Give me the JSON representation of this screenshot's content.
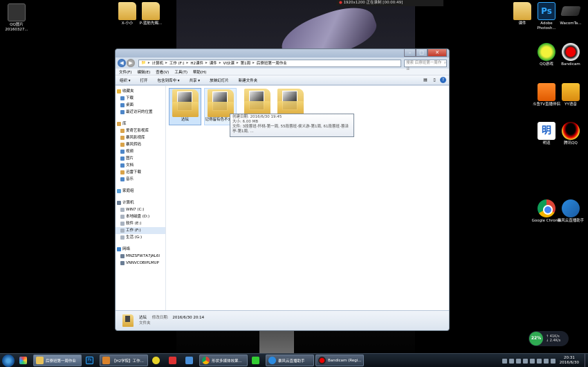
{
  "recorder": {
    "text": "1920x1200 正在录制 [00:00:49]"
  },
  "desktop_icons": {
    "qq_image": "QQ图片 20160327...",
    "x_xiaoxiao": "X-小小",
    "p_lanfang": "P-蓝舫先赐...",
    "kejian": "课件",
    "adobe_ps": "Adobe Photosh...",
    "wacom": "WacomTa...",
    "qq_game": "QQ游戏",
    "bandicam": "Bandicam",
    "douyu": "斗鱼TV直播伴侣",
    "yy": "YY语音",
    "mingdao": "明道",
    "qq": "腾讯QQ",
    "chrome": "Google Chrome",
    "storm": "暴风云直播助手"
  },
  "window": {
    "address": [
      "计算机",
      "工作 (F:)",
      "H2课件",
      "课件",
      "VI伙课",
      "第1周",
      "后寮班第一周作业"
    ],
    "search_placeholder": "搜索 后寮班第一周作业",
    "menu": [
      "文件(F)",
      "编辑(E)",
      "查看(V)",
      "工具(T)",
      "帮助(H)"
    ],
    "commands": [
      "组织 ▾",
      "打开",
      "包含到库中 ▾",
      "共享 ▾",
      "放映幻灯片",
      "新建文件夹"
    ],
    "nav": {
      "favorites_header": "收藏夹",
      "favorites": [
        "下载",
        "桌面",
        "最近访问的位置"
      ],
      "libraries_header": "库",
      "libraries": [
        "爱奇艺影视库",
        "暴风影视库",
        "暴风转码",
        "视频",
        "图片",
        "文档",
        "迅雷下载",
        "音乐"
      ],
      "homegroup": "家庭组",
      "computer_header": "计算机",
      "drives": [
        "WIN7 (C:)",
        "本地磁盘 (D:)",
        "软件 (E:)",
        "工作 (F:)",
        "生活 (G:)"
      ],
      "network_header": "网络",
      "network": [
        "MNZSFW7A7JAL6I",
        "VNNVCOBIPLMUP"
      ]
    },
    "files": [
      "达坛",
      "记得留有色不去我",
      "",
      ""
    ],
    "tooltip": {
      "created": "创建日期: 2016/6/30 19:45",
      "size": "大小: 6.00 MB",
      "files": "文件: 3段蓉班-怀桃-第一周, 55段蓉班-侯义游-第1周, 61段蓉班-蓉泽亭-第1周, ..."
    },
    "details": {
      "name": "达坛",
      "modified_label": "修改日期:",
      "modified": "2016/6/30 20:14",
      "type": "文件夹"
    }
  },
  "tray": {
    "percent": "22%",
    "up": "41K/s",
    "down": "2.4K/s",
    "time": "20:31",
    "date": "2016/6/30"
  },
  "taskbar": {
    "items": [
      "后寮班第一周作业",
      "Ps",
      "【H2学院】工作...",
      "形状多媒体效果...",
      "暴风云直播助手",
      "Bandicam (Regi..."
    ]
  }
}
